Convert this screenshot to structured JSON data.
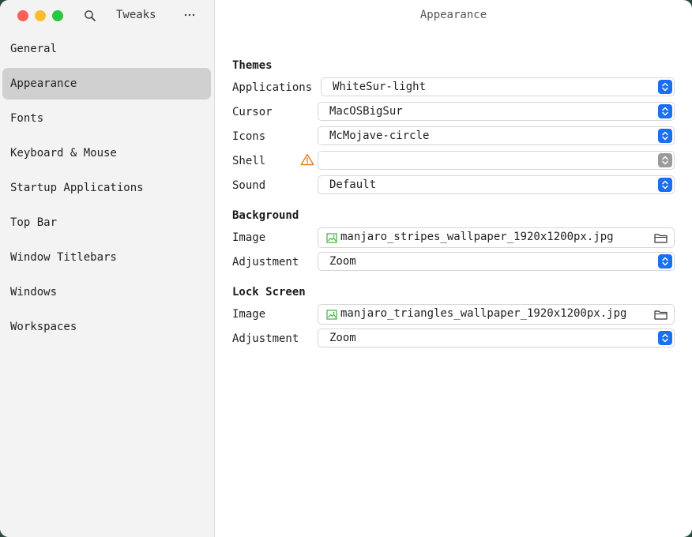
{
  "window": {
    "app_title": "Tweaks"
  },
  "sidebar": {
    "items": [
      {
        "label": "General"
      },
      {
        "label": "Appearance",
        "active": true
      },
      {
        "label": "Fonts"
      },
      {
        "label": "Keyboard & Mouse"
      },
      {
        "label": "Startup Applications"
      },
      {
        "label": "Top Bar"
      },
      {
        "label": "Window Titlebars"
      },
      {
        "label": "Windows"
      },
      {
        "label": "Workspaces"
      }
    ]
  },
  "main": {
    "title": "Appearance",
    "themes": {
      "heading": "Themes",
      "applications": {
        "label": "Applications",
        "value": "WhiteSur-light"
      },
      "cursor": {
        "label": "Cursor",
        "value": "MacOSBigSur"
      },
      "icons": {
        "label": "Icons",
        "value": "McMojave-circle"
      },
      "shell": {
        "label": "Shell",
        "value": ""
      },
      "sound": {
        "label": "Sound",
        "value": "Default"
      }
    },
    "background": {
      "heading": "Background",
      "image": {
        "label": "Image",
        "value": "manjaro_stripes_wallpaper_1920x1200px.jpg"
      },
      "adjustment": {
        "label": "Adjustment",
        "value": "Zoom"
      }
    },
    "lock_screen": {
      "heading": "Lock Screen",
      "image": {
        "label": "Image",
        "value": "manjaro_triangles_wallpaper_1920x1200px.jpg"
      },
      "adjustment": {
        "label": "Adjustment",
        "value": "Zoom"
      }
    }
  },
  "colors": {
    "accent": "#1a6ff2",
    "close": "#fe5f57",
    "minimize": "#febc2e",
    "maximize": "#28c840",
    "warning": "#e67e22",
    "image_icon": "#3fae3f"
  },
  "icons": {
    "search": "search-icon",
    "more": "more-icon",
    "warning": "warning-icon",
    "image": "image-file-icon",
    "folder": "folder-icon",
    "chevron": "chevron-up-down-icon"
  }
}
